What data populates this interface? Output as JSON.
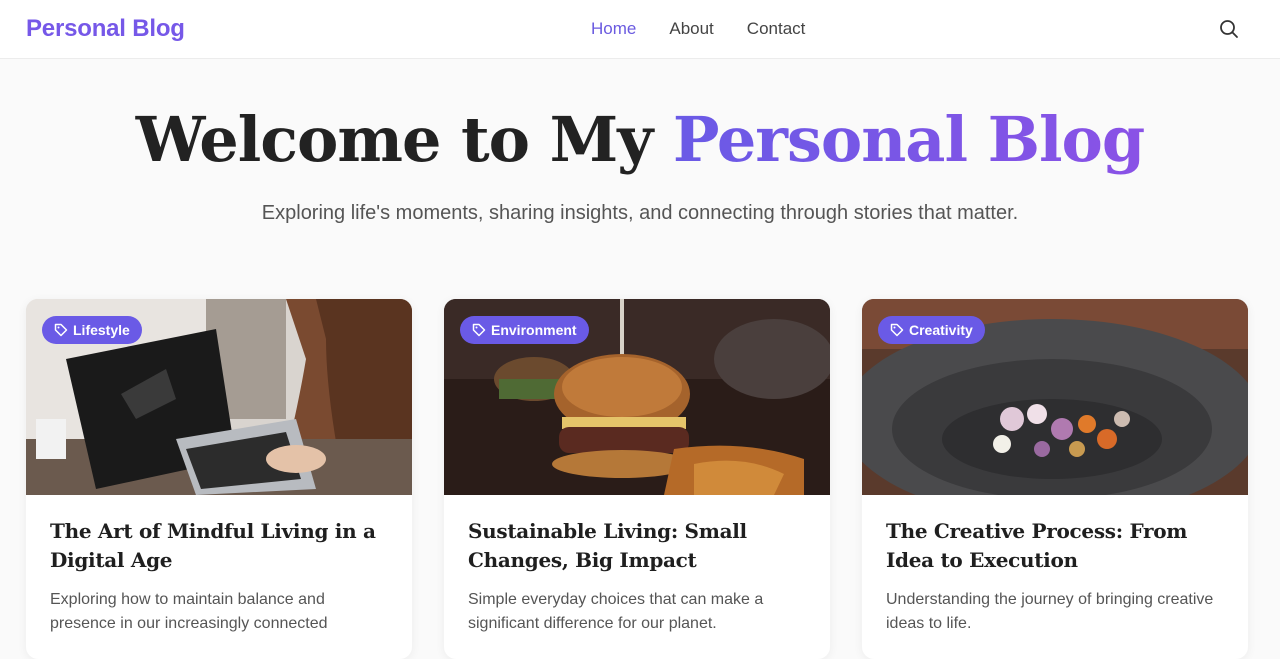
{
  "header": {
    "brand": "Personal Blog",
    "nav": [
      {
        "label": "Home",
        "active": true
      },
      {
        "label": "About",
        "active": false
      },
      {
        "label": "Contact",
        "active": false
      }
    ],
    "search_icon": "search-icon"
  },
  "hero": {
    "title_start": "Welcome to My ",
    "title_accent": "Personal Blog",
    "subtitle": "Exploring life's moments, sharing insights, and connecting through stories that matter."
  },
  "posts": [
    {
      "tag": "Lifestyle",
      "image": "laptop-woman-photo",
      "title": "The Art of Mindful Living in a Digital Age",
      "excerpt": "Exploring how to maintain balance and presence in our increasingly connected"
    },
    {
      "tag": "Environment",
      "image": "burger-photo",
      "title": "Sustainable Living: Small Changes, Big Impact",
      "excerpt": "Simple everyday choices that can make a significant difference for our planet."
    },
    {
      "tag": "Creativity",
      "image": "mortar-bowl-photo",
      "title": "The Creative Process: From Idea to Execution",
      "excerpt": "Understanding the journey of bringing creative ideas to life."
    }
  ],
  "colors": {
    "accent": "#6a5ae6",
    "brand": "#7658e8",
    "text": "#222222"
  }
}
